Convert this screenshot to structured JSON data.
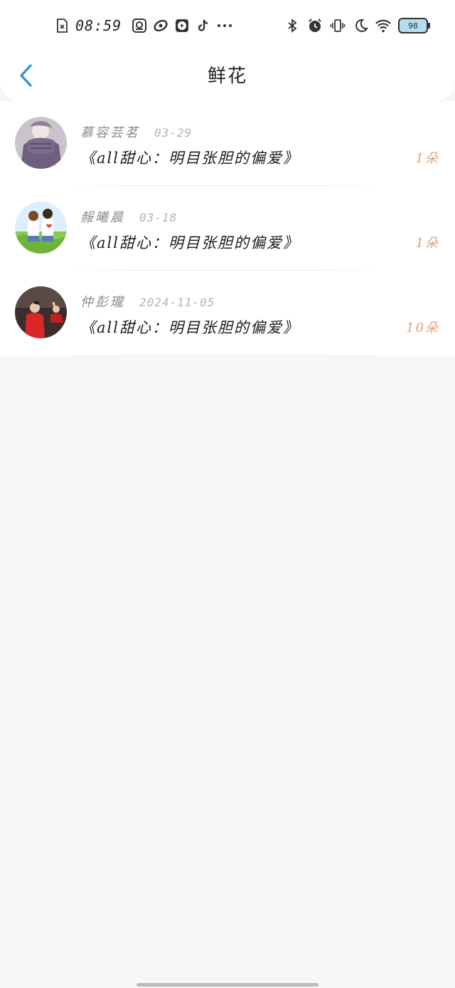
{
  "status_bar": {
    "time": "08:59",
    "battery": "98",
    "left_icons": [
      "sim-off-icon",
      "search-app-icon",
      "orbit-app-icon",
      "video-app-icon",
      "tiktok-icon",
      "more-dots-icon"
    ],
    "right_icons": [
      "bluetooth-icon",
      "alarm-icon",
      "vibrate-icon",
      "moon-icon",
      "wifi-icon"
    ]
  },
  "nav": {
    "title": "鲜花",
    "back_icon": "back-arrow-icon"
  },
  "list": {
    "items": [
      {
        "name": "慕容芸茗",
        "date": "03-29",
        "title": "《all甜心：明目张胆的偏爱》",
        "count": "1朵",
        "avatar": "avatar-scarf-person"
      },
      {
        "name": "赧曦晨",
        "date": "03-18",
        "title": "《all甜心：明目张胆的偏爱》",
        "count": "1朵",
        "avatar": "avatar-cartoon-couple"
      },
      {
        "name": "仲彭瓏",
        "date": "2024-11-05",
        "title": "《all甜心：明目张胆的偏爱》",
        "count": "10朵",
        "avatar": "avatar-stage-performers"
      }
    ]
  },
  "colors": {
    "accent_blue": "#2d8fe0",
    "count_orange": "#e3a06f",
    "background": "#f8f6f7"
  }
}
